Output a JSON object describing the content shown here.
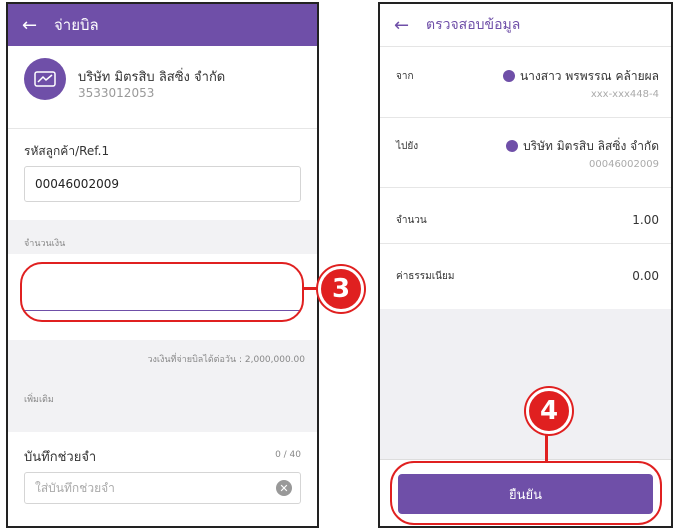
{
  "left_screen": {
    "header": {
      "back_icon": "back-arrow-icon",
      "title": "จ่ายบิล"
    },
    "biller": {
      "name": "บริษัท มิตรสิบ ลิสซิ่ง จำกัด",
      "code": "3533012053",
      "icon": "chart-line-icon"
    },
    "ref": {
      "label": "รหัสลูกค้า/Ref.1",
      "value": "00046002009"
    },
    "amount": {
      "section_label": "จำนวนเงิน",
      "value": "",
      "limit_text": "วงเงินที่จ่ายบิลได้ต่อวัน : 2,000,000.00"
    },
    "extra": {
      "section_label": "เพิ่มเติม"
    },
    "memo": {
      "label": "บันทึกช่วยจำ",
      "counter": "0 / 40",
      "placeholder": "ใส่บันทึกช่วยจำ",
      "clear_icon": "clear-circle-icon"
    }
  },
  "right_screen": {
    "header": {
      "back_icon": "back-arrow-icon",
      "title": "ตรวจสอบข้อมูล"
    },
    "from": {
      "label": "จาก",
      "name": "นางสาว พรพรรณ คล้ายผล",
      "account": "xxx-xxx448-4"
    },
    "to": {
      "label": "ไปยัง",
      "name": "บริษัท มิตรสิบ ลิสซิ่ง จำกัด",
      "account": "00046002009"
    },
    "amount": {
      "label": "จำนวน",
      "value": "1.00"
    },
    "fee": {
      "label": "ค่าธรรมเนียม",
      "value": "0.00"
    },
    "confirm_label": "ยืนยัน"
  },
  "callouts": {
    "step3": "3",
    "step4": "4"
  },
  "colors": {
    "brand": "#6f4fa8",
    "callout": "#e02020"
  }
}
